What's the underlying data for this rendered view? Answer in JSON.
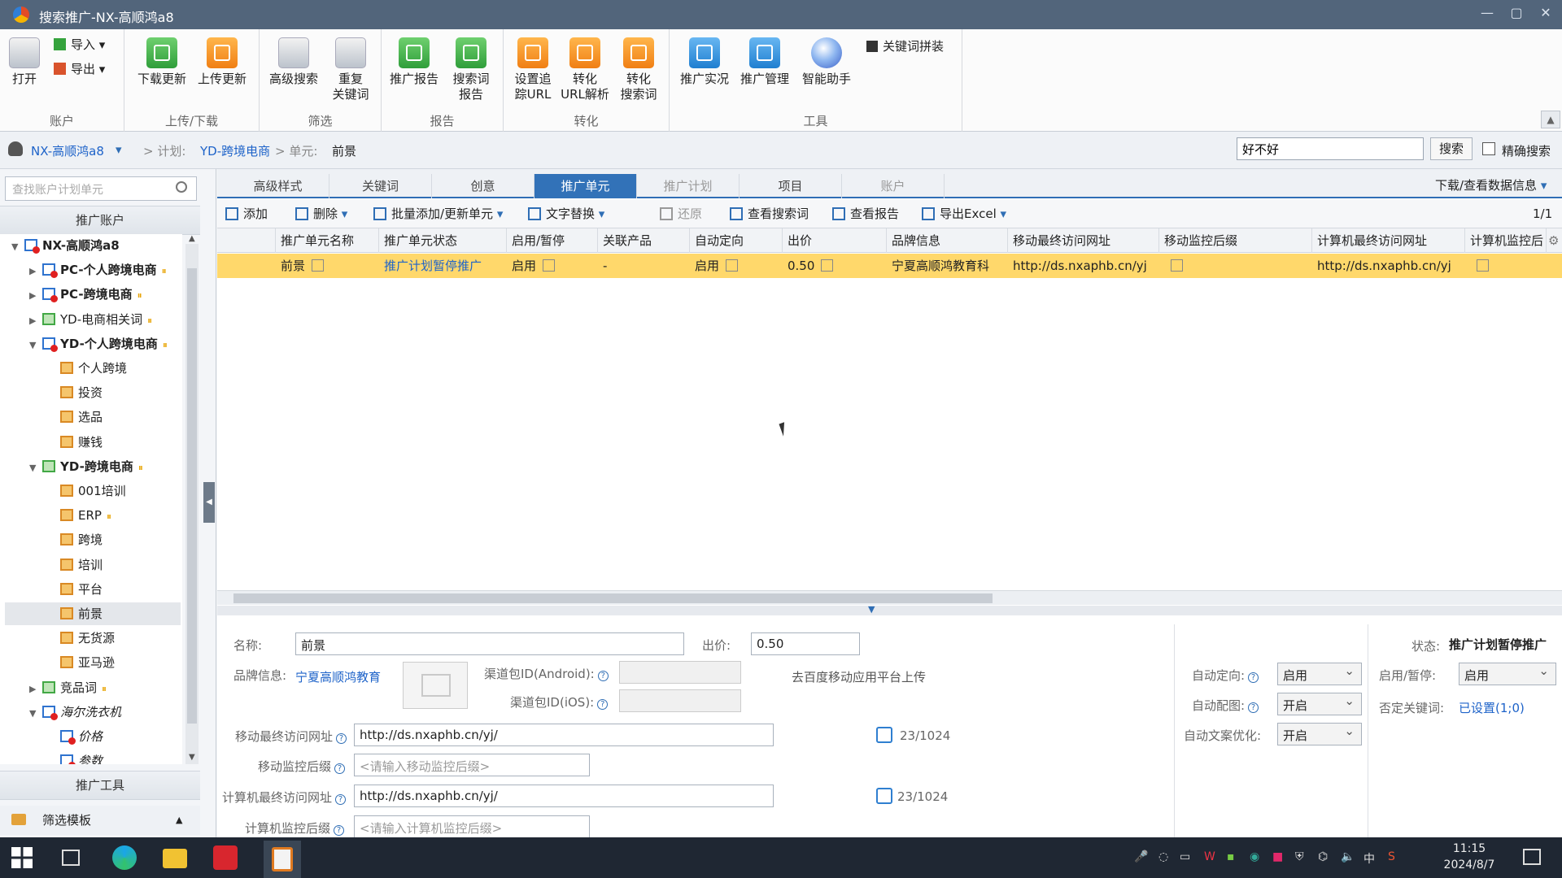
{
  "window": {
    "title": "搜索推广-NX-高顺鸿a8",
    "min": "—",
    "max": "▢",
    "close": "✕"
  },
  "ribbon": {
    "groups": [
      {
        "label": "账户"
      },
      {
        "label": "上传/下载"
      },
      {
        "label": "筛选"
      },
      {
        "label": "报告"
      },
      {
        "label": "转化"
      },
      {
        "label": "工具"
      }
    ],
    "buttons": {
      "open": "打开",
      "import": "导入",
      "export": "导出",
      "download": "下载更新",
      "upload": "上传更新",
      "advanced_search": "高级搜索",
      "dup_kw": "重复\n关键词",
      "promo_report": "推广报告",
      "search_report": "搜索词\n报告",
      "set_track": "设置追\n踪URL",
      "conv_url": "转化\nURL解析",
      "conv_search": "转化\n搜索词",
      "live": "推广实况",
      "manage": "推广管理",
      "assistant": "智能助手",
      "kw_combine": "关键词拼装"
    }
  },
  "breadcrumb": {
    "account": "NX-高顺鸿a8",
    "plan_label": "> 计划:",
    "plan": "YD-跨境电商",
    "unit_label": "> 单元:",
    "unit": "前景"
  },
  "search": {
    "value": "好不好",
    "button": "搜索",
    "exact": "精确搜索"
  },
  "sidebar": {
    "search_placeholder": "查找账户计划单元",
    "header": "推广账户",
    "tools": "推广工具",
    "template": "筛选模板",
    "tree": [
      {
        "label": "NX-高顺鸿a8",
        "level": 0,
        "arrow": "▼",
        "icon": "red",
        "bold": true
      },
      {
        "label": "PC-个人跨境电商",
        "level": 1,
        "arrow": "▶",
        "icon": "red",
        "bold": true,
        "pause": true
      },
      {
        "label": "PC-跨境电商",
        "level": 1,
        "arrow": "▶",
        "icon": "red",
        "bold": true,
        "pause": true
      },
      {
        "label": "YD-电商相关词",
        "level": 1,
        "arrow": "▶",
        "icon": "green",
        "pause": true
      },
      {
        "label": "YD-个人跨境电商",
        "level": 1,
        "arrow": "▼",
        "icon": "red",
        "bold": true,
        "pause": true
      },
      {
        "label": "个人跨境",
        "level": 2,
        "icon": "orange"
      },
      {
        "label": "投资",
        "level": 2,
        "icon": "orange"
      },
      {
        "label": "选品",
        "level": 2,
        "icon": "orange"
      },
      {
        "label": "赚钱",
        "level": 2,
        "icon": "orange"
      },
      {
        "label": "YD-跨境电商",
        "level": 1,
        "arrow": "▼",
        "icon": "green",
        "bold": true,
        "pause": true
      },
      {
        "label": "001培训",
        "level": 2,
        "icon": "orange"
      },
      {
        "label": "ERP",
        "level": 2,
        "icon": "orange",
        "pause": true
      },
      {
        "label": "跨境",
        "level": 2,
        "icon": "orange"
      },
      {
        "label": "培训",
        "level": 2,
        "icon": "orange"
      },
      {
        "label": "平台",
        "level": 2,
        "icon": "orange"
      },
      {
        "label": "前景",
        "level": 2,
        "icon": "orange",
        "selected": true
      },
      {
        "label": "无货源",
        "level": 2,
        "icon": "orange"
      },
      {
        "label": "亚马逊",
        "level": 2,
        "icon": "orange"
      },
      {
        "label": "竞品词",
        "level": 1,
        "arrow": "▶",
        "icon": "green",
        "pause": true
      },
      {
        "label": "海尔洗衣机",
        "level": 1,
        "arrow": "▼",
        "icon": "red",
        "italic": true
      },
      {
        "label": "价格",
        "level": 2,
        "icon": "red",
        "italic": true
      },
      {
        "label": "参数",
        "level": 2,
        "icon": "red",
        "italic": true
      }
    ]
  },
  "tabs": [
    "高级样式",
    "关键词",
    "创意",
    "推广单元",
    "推广计划",
    "项目",
    "账户"
  ],
  "download_info": "下载/查看数据信息",
  "toolbar": {
    "add": "添加",
    "delete": "删除",
    "batch": "批量添加/更新单元",
    "replace": "文字替换",
    "restore": "还原",
    "view_search": "查看搜索词",
    "view_report": "查看报告",
    "export_excel": "导出Excel",
    "page": "1/1"
  },
  "columns": [
    "推广单元名称",
    "推广单元状态",
    "启用/暂停",
    "关联产品",
    "自动定向",
    "出价",
    "品牌信息",
    "移动最终访问网址",
    "移动监控后缀",
    "计算机最终访问网址",
    "计算机监控后"
  ],
  "row": {
    "name": "前景",
    "status": "推广计划暂停推广",
    "enabled": "启用",
    "product": "-",
    "auto_target": "启用",
    "bid": "0.50",
    "brand": "宁夏高顺鸿教育科",
    "mobile_url": "http://ds.nxaphb.cn/yj",
    "pc_url": "http://ds.nxaphb.cn/yj"
  },
  "form": {
    "name_label": "名称:",
    "name": "前景",
    "bid_label": "出价:",
    "bid": "0.50",
    "brand_label": "品牌信息:",
    "brand": "宁夏高顺鸿教育",
    "android_label": "渠道包ID(Android):",
    "ios_label": "渠道包ID(iOS):",
    "upload_hint": "去百度移动应用平台上传",
    "mobile_url_label": "移动最终访问网址",
    "mobile_url": "http://ds.nxaphb.cn/yj/",
    "mobile_count": "23/1024",
    "mobile_suffix_label": "移动监控后缀",
    "mobile_suffix_ph": "<请输入移动监控后缀>",
    "pc_url_label": "计算机最终访问网址",
    "pc_url": "http://ds.nxaphb.cn/yj/",
    "pc_count": "23/1024",
    "pc_suffix_label": "计算机监控后缀",
    "pc_suffix_ph": "<请输入计算机监控后缀>",
    "auto_target_label": "自动定向:",
    "auto_target": "启用",
    "auto_image_label": "自动配图:",
    "auto_image": "开启",
    "auto_copy_label": "自动文案优化:",
    "auto_copy": "开启",
    "status_label": "状态:",
    "status": "推广计划暂停推广",
    "enable_label": "启用/暂停:",
    "enable": "启用",
    "neg_label": "否定关键词:",
    "neg": "已设置(1;0)"
  },
  "taskbar": {
    "time": "11:15",
    "date": "2024/8/7",
    "ime": "中"
  }
}
